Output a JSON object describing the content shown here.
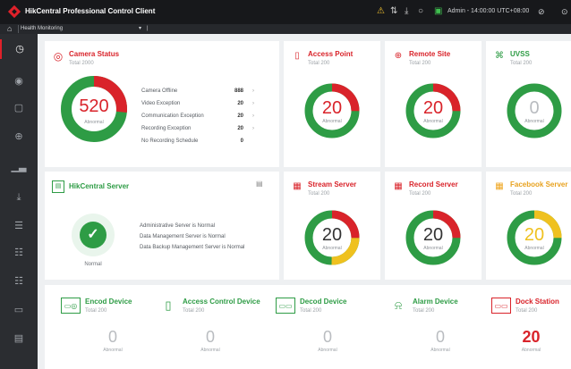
{
  "app": {
    "title": "HikCentral Professional Control Client",
    "user": "Admin - 14:00:00 UTC+08:00"
  },
  "nav": {
    "home_icon": "⌂",
    "tab": "Health Monitoring",
    "dropdown": "▾",
    "bar": "|"
  },
  "camera": {
    "title": "Camera Status",
    "subtitle": "Total 2000",
    "value": "520",
    "label": "Abnormal",
    "stats": [
      {
        "label": "Camera Offline",
        "value": "888"
      },
      {
        "label": "Video Exception",
        "value": "20"
      },
      {
        "label": "Communication Exception",
        "value": "20"
      },
      {
        "label": "Recording Exception",
        "value": "20"
      },
      {
        "label": "No Recording Schedule",
        "value": "0"
      }
    ]
  },
  "server": {
    "title": "HikCentral Server",
    "status": "Normal",
    "lines": [
      "Administrative Server is Normal",
      "Data Management Server is Normal",
      "Data Backup Management Server is Normal"
    ]
  },
  "cards": [
    {
      "title": "Access Point",
      "subtitle": "Total 200",
      "value": "20",
      "label": "Abnormal"
    },
    {
      "title": "Remote Site",
      "subtitle": "Total 200",
      "value": "20",
      "label": "Abnormal"
    },
    {
      "title": "UVSS",
      "subtitle": "Total 200",
      "value": "0",
      "label": "Abnormal"
    },
    {
      "title": "Stream Server",
      "subtitle": "Total 200",
      "value": "20",
      "label": "Abnormal"
    },
    {
      "title": "Record Server",
      "subtitle": "Total 200",
      "value": "20",
      "label": "Abnormal"
    },
    {
      "title": "Facebook Server",
      "subtitle": "Total 200",
      "value": "20",
      "label": "Abnormal"
    }
  ],
  "devices": [
    {
      "title": "Encod Device",
      "subtitle": "Total 200",
      "value": "0",
      "label": "Abnormal"
    },
    {
      "title": "Access Control Device",
      "subtitle": "Total 200",
      "value": "0",
      "label": "Abnormal"
    },
    {
      "title": "Decod Device",
      "subtitle": "Total 200",
      "value": "0",
      "label": "Abnormal"
    },
    {
      "title": "Alarm Device",
      "subtitle": "Total 200",
      "value": "0",
      "label": "Abnormal"
    },
    {
      "title": "Dock Station",
      "subtitle": "Total 200",
      "value": "20",
      "label": "Abnormal"
    }
  ],
  "colors": {
    "accent": "#d9232a",
    "green": "#2e9c45",
    "yellow": "#efc11f",
    "gray": "#b9bcc0"
  }
}
